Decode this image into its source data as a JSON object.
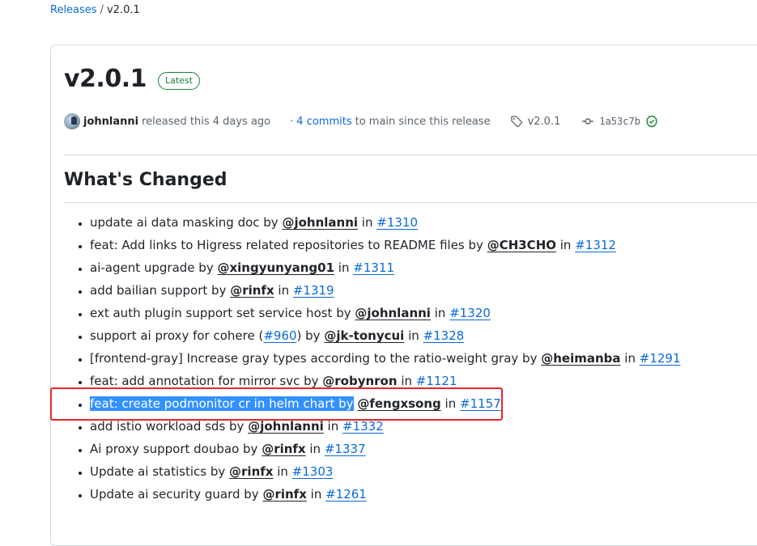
{
  "breadcrumb": {
    "parent": "Releases",
    "separator": "/",
    "current": "v2.0.1"
  },
  "release": {
    "title": "v2.0.1",
    "badge": "Latest",
    "author": "johnlanni",
    "released_text": "released this 4 days ago",
    "dot": "·",
    "commits_link": "4 commits",
    "commits_suffix": "to main since this release",
    "tag": "v2.0.1",
    "commit_sha": "1a53c7b",
    "verified_icon": "check-circle-icon"
  },
  "section": {
    "heading": "What's Changed"
  },
  "changes": [
    {
      "text": "update ai data masking doc by ",
      "user": "@johnlanni",
      "in": " in ",
      "pr": "#1310"
    },
    {
      "text": "feat: Add links to Higress related repositories to README files by ",
      "user": "@CH3CHO",
      "in": " in ",
      "pr": "#1312"
    },
    {
      "text": "ai-agent upgrade by ",
      "user": "@xingyunyang01",
      "in": " in ",
      "pr": "#1311"
    },
    {
      "text": "add bailian support by ",
      "user": "@rinfx",
      "in": " in ",
      "pr": "#1319"
    },
    {
      "text": "ext auth plugin support set service host by ",
      "user": "@johnlanni",
      "in": " in ",
      "pr": "#1320"
    },
    {
      "text": "support ai proxy for cohere (",
      "inline_pr": "#960",
      "text2": ") by ",
      "user": "@jk-tonycui",
      "in": " in ",
      "pr": "#1328"
    },
    {
      "text": "[frontend-gray] Increase gray types according to the ratio-weight gray by ",
      "user": "@heimanba",
      "in": " in ",
      "pr": "#1291"
    },
    {
      "text": "feat: add annotation for mirror svc by ",
      "user": "@robynron",
      "in": " in ",
      "pr": "#1121"
    },
    {
      "text": "feat: create podmonitor cr in helm chart by",
      "text_space": " ",
      "user": "@fengxsong",
      "in": " in ",
      "pr": "#1157",
      "highlighted": true
    },
    {
      "text": "add istio workload sds by ",
      "user": "@johnlanni",
      "in": " in ",
      "pr": "#1332"
    },
    {
      "text": "Ai proxy support doubao by ",
      "user": "@rinfx",
      "in": " in ",
      "pr": "#1337"
    },
    {
      "text": "Update ai statistics by ",
      "user": "@rinfx",
      "in": " in ",
      "pr": "#1303"
    },
    {
      "text": "Update ai security guard by ",
      "user": "@rinfx",
      "in": " in ",
      "pr": "#1261"
    }
  ],
  "colors": {
    "link": "#0969da",
    "latest_badge": "#1a7f37",
    "selection_highlight": "#3390ff",
    "annotation_box": "#e8262b"
  }
}
